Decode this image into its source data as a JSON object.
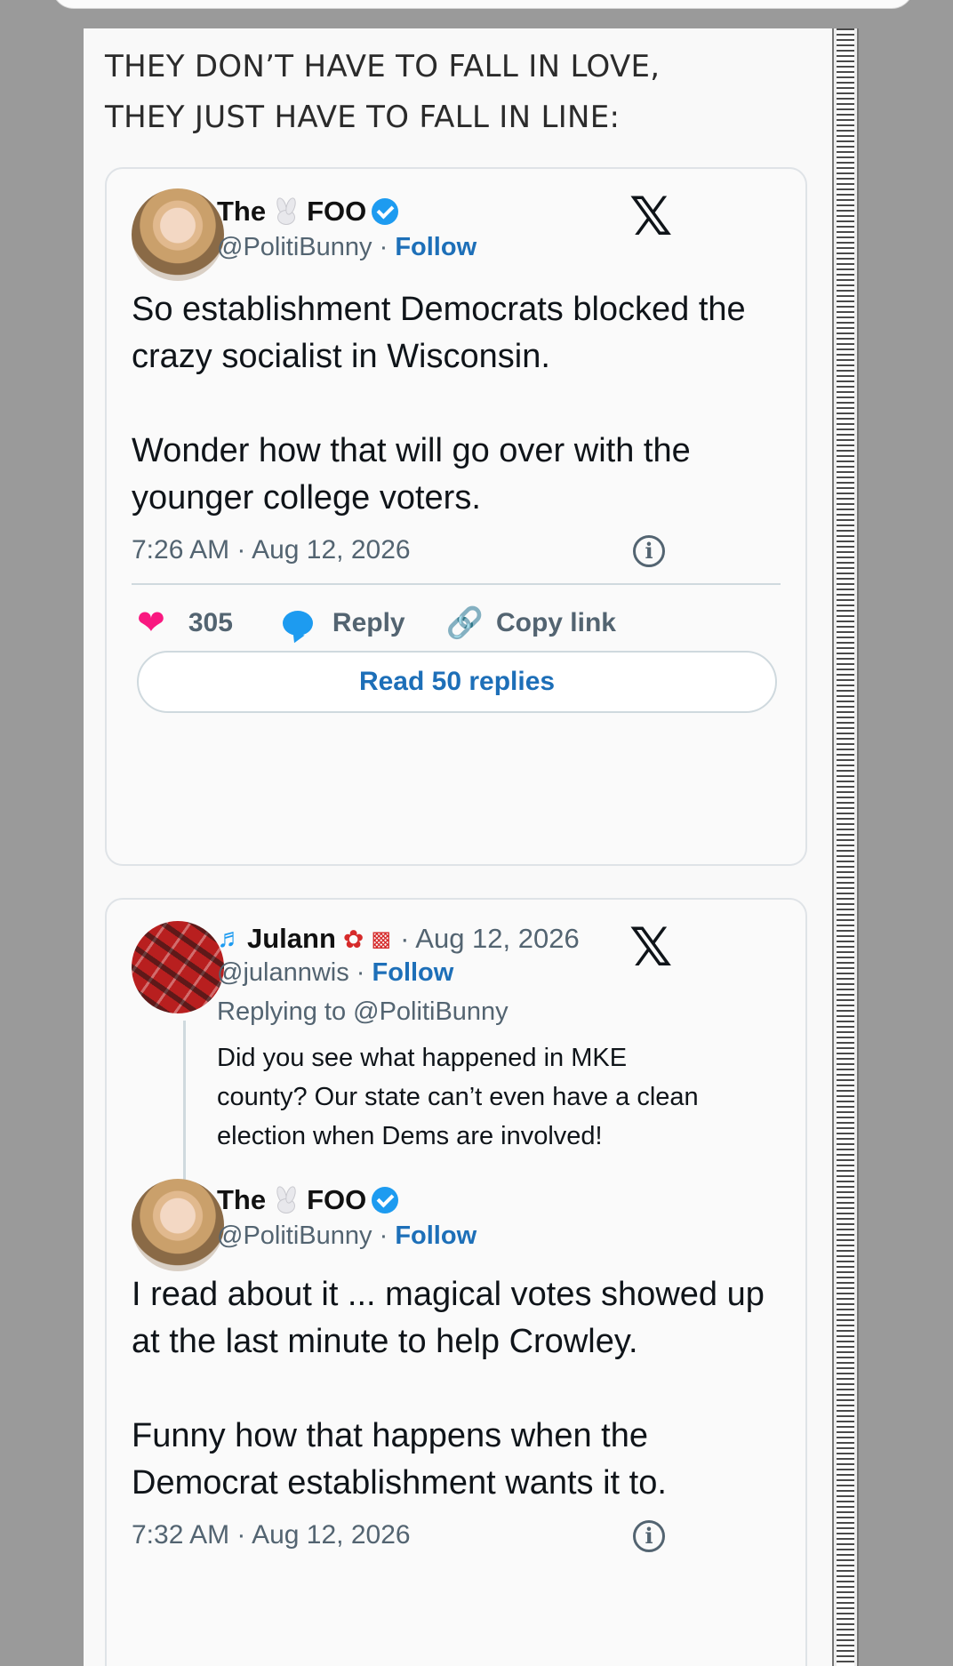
{
  "headline": {
    "line1": "THEY DON’T HAVE TO FALL IN LOVE,",
    "line2": "THEY JUST HAVE TO FALL IN LINE:"
  },
  "tweet1": {
    "name_prefix": "The",
    "name_suffix": "FOO",
    "handle": "@PolitiBunny",
    "separator": " · ",
    "follow": "Follow",
    "platform_logo": "𝕏",
    "paragraph1": "So establishment Democrats blocked the crazy socialist in Wisconsin.",
    "paragraph2": "Wonder how that will go over with the younger college voters.",
    "timestamp": "7:26 AM · Aug 12, 2026",
    "info": "i",
    "likes": "305",
    "reply_label": "Reply",
    "copy_link_label": "Copy link",
    "read_replies": "Read 50 replies"
  },
  "tweet2": {
    "reply_author": {
      "name": "Julann",
      "date": "· Aug 12, 2026",
      "handle": "@julannwis",
      "follow": "Follow",
      "replying_to": "Replying to @PolitiBunny",
      "text": "Did you see what happened in MKE county? Our state can’t even have a clean election when Dems are involved!"
    },
    "platform_logo": "𝕏",
    "main": {
      "name_prefix": "The",
      "name_suffix": "FOO",
      "handle": "@PolitiBunny",
      "follow": "Follow",
      "paragraph1": "I read about it ... magical votes showed up at the last minute to help Crowley.",
      "paragraph2": "Funny how that happens when the Democrat establishment wants it to.",
      "timestamp": "7:32 AM · Aug 12, 2026",
      "info": "i"
    }
  },
  "colors": {
    "accent": "#1d6fb8",
    "verified": "#1d9bf0",
    "like": "#f91880"
  }
}
